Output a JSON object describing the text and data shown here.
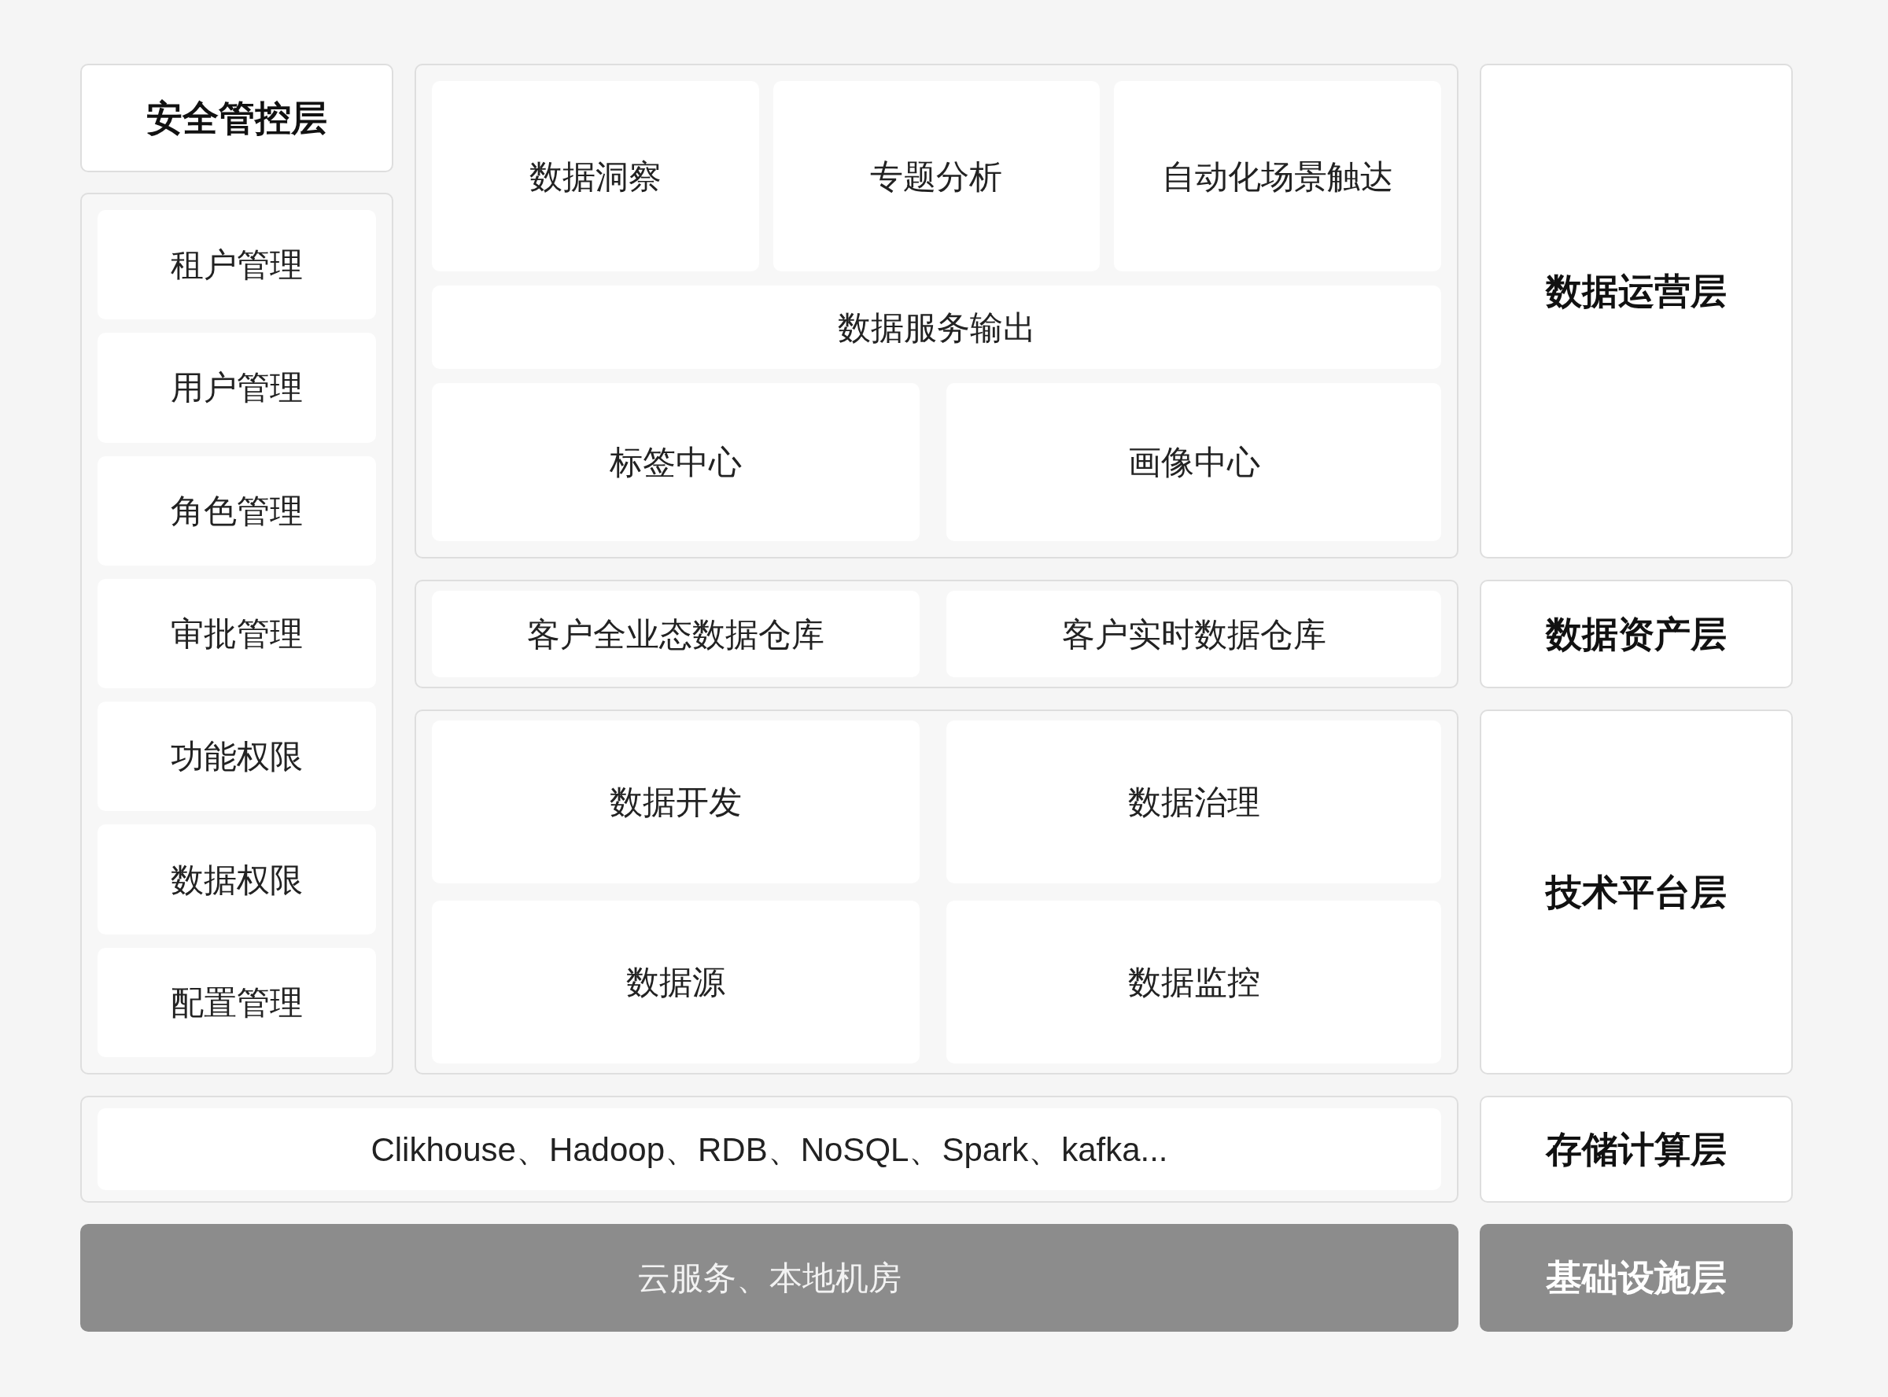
{
  "security": {
    "title": "安全管控层",
    "items": [
      "租户管理",
      "用户管理",
      "角色管理",
      "审批管理",
      "功能权限",
      "数据权限",
      "配置管理"
    ]
  },
  "operations": {
    "apps": [
      "数据洞察",
      "专题分析",
      "自动化场景触达"
    ],
    "service": "数据服务输出",
    "centers": [
      "标签中心",
      "画像中心"
    ],
    "layer": "数据运营层"
  },
  "assets": {
    "warehouses": [
      "客户全业态数据仓库",
      "客户实时数据仓库"
    ],
    "layer": "数据资产层"
  },
  "platform": {
    "modules": [
      "数据开发",
      "数据治理",
      "数据源",
      "数据监控"
    ],
    "layer": "技术平台层"
  },
  "storage": {
    "text": "Clikhouse、Hadoop、RDB、NoSQL、Spark、kafka...",
    "layer": "存储计算层"
  },
  "infrastructure": {
    "text": "云服务、本地机房",
    "layer": "基础设施层"
  }
}
